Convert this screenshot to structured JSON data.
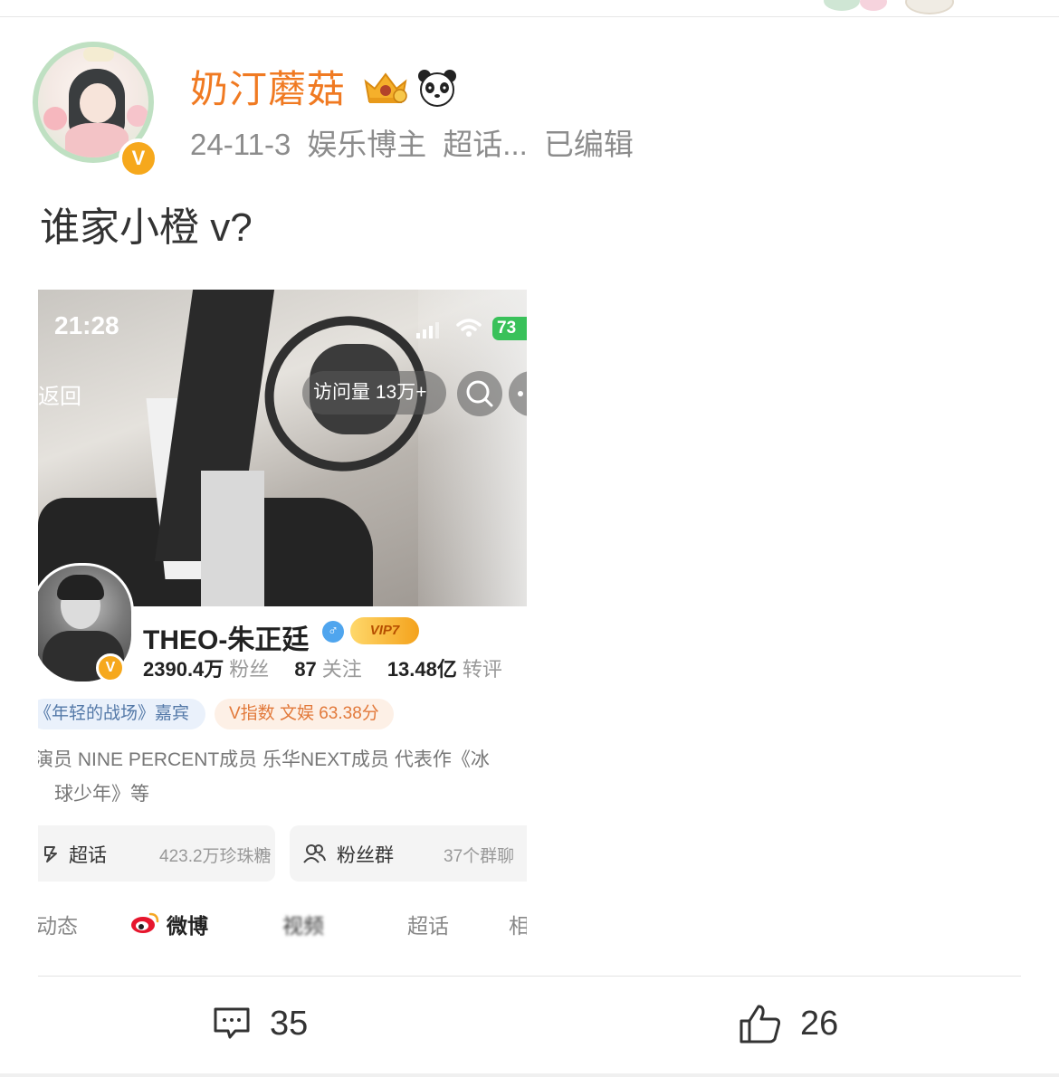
{
  "post": {
    "author_name": "奶汀蘑菇",
    "date": "24-11-3",
    "author_tag": "娱乐博主",
    "topic_tag": "超话...",
    "edited_label": "已编辑",
    "text": "谁家小橙 v?",
    "icons": {
      "avatar_badge": "v-verified-icon",
      "level_badge": "crown-badge-icon",
      "fan_badge": "panda-icon"
    },
    "colors": {
      "username": "#f07a22",
      "verified": "#f6a81c"
    }
  },
  "screenshot": {
    "status_time": "21:28",
    "battery": "73",
    "back_label": "返回",
    "visits_label": "访问量 13万+",
    "profile_name": "THEO-朱正廷",
    "vip_label": "VIP7",
    "fans_count": "2390.4万",
    "fans_label": "粉丝",
    "following_count": "87",
    "following_label": "关注",
    "reposts_count": "13.48亿",
    "reposts_label": "转评",
    "tag_guest": "《年轻的战场》嘉宾",
    "tag_vindex": "V指数 文娱 63.38分",
    "bio_line1": "演员 NINE PERCENT成员 乐华NEXT成员 代表作《冰",
    "bio_line2": "球少年》等",
    "card_supertopic_title": "超话",
    "card_supertopic_sub": "423.2万珍珠糖",
    "card_fangroup_title": "粉丝群",
    "card_fangroup_sub": "37个群聊",
    "tabs": [
      "动态",
      "微博",
      "视频",
      "超话",
      "相"
    ]
  },
  "actions": {
    "comments_count": "35",
    "likes_count": "26"
  }
}
